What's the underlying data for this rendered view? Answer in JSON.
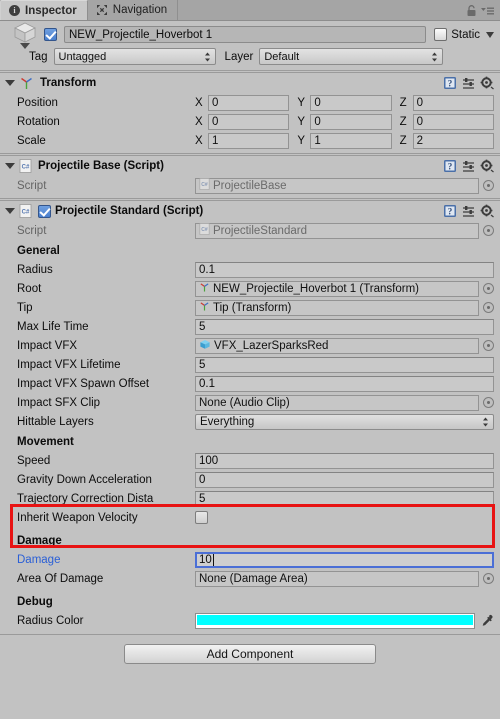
{
  "tabs": [
    {
      "label": "Inspector",
      "icon": "info-icon",
      "active": true
    },
    {
      "label": "Navigation",
      "icon": "navigation-icon",
      "active": false
    }
  ],
  "window_controls": {
    "lock": "lock-icon",
    "menu": "menu-icon"
  },
  "gameobject": {
    "icon": "gameobject-cube-icon",
    "enabled": true,
    "name": "NEW_Projectile_Hoverbot 1",
    "static_label": "Static",
    "static_checked": false,
    "tag_label": "Tag",
    "tag_value": "Untagged",
    "layer_label": "Layer",
    "layer_value": "Default"
  },
  "components": {
    "transform": {
      "title": "Transform",
      "icon": "transform-axis-icon",
      "rows": [
        {
          "label": "Position",
          "x": "0",
          "y": "0",
          "z": "0"
        },
        {
          "label": "Rotation",
          "x": "0",
          "y": "0",
          "z": "0"
        },
        {
          "label": "Scale",
          "x": "1",
          "y": "1",
          "z": "2"
        }
      ],
      "axes": {
        "x": "X",
        "y": "Y",
        "z": "Z"
      }
    },
    "projectile_base": {
      "title": "Projectile Base (Script)",
      "icon": "csharp-script-icon",
      "script_label": "Script",
      "script_value": "ProjectileBase"
    },
    "projectile_standard": {
      "title": "Projectile Standard (Script)",
      "icon": "csharp-script-icon",
      "enabled": true,
      "script_label": "Script",
      "script_value": "ProjectileStandard",
      "sections": {
        "general": {
          "header": "General",
          "radius_label": "Radius",
          "radius_value": "0.1",
          "root_label": "Root",
          "root_value": "NEW_Projectile_Hoverbot 1 (Transform)",
          "tip_label": "Tip",
          "tip_value": "Tip (Transform)",
          "max_life_label": "Max Life Time",
          "max_life_value": "5",
          "impact_vfx_label": "Impact VFX",
          "impact_vfx_value": "VFX_LazerSparksRed",
          "impact_vfx_lifetime_label": "Impact VFX Lifetime",
          "impact_vfx_lifetime_value": "5",
          "impact_vfx_offset_label": "Impact VFX Spawn Offset",
          "impact_vfx_offset_value": "0.1",
          "impact_sfx_label": "Impact SFX Clip",
          "impact_sfx_value": "None (Audio Clip)",
          "hittable_layers_label": "Hittable Layers",
          "hittable_layers_value": "Everything"
        },
        "movement": {
          "header": "Movement",
          "speed_label": "Speed",
          "speed_value": "100",
          "gravity_label": "Gravity Down Acceleration",
          "gravity_value": "0",
          "trajectory_label": "Trajectory Correction Dista",
          "trajectory_value": "5",
          "inherit_label": "Inherit Weapon Velocity",
          "inherit_checked": false
        },
        "damage": {
          "header": "Damage",
          "damage_label": "Damage",
          "damage_value": "10",
          "damage_focused": true,
          "area_label": "Area Of Damage",
          "area_value": "None (Damage Area)"
        },
        "debug": {
          "header": "Debug",
          "radius_color_label": "Radius Color",
          "radius_color_value": "#00FFFF"
        }
      }
    }
  },
  "add_component": {
    "label": "Add Component"
  },
  "colors": {
    "panel_bg": "#c2c2c2",
    "accent_blue": "#4b6fd6",
    "annotation_red": "#e81313",
    "link_blue": "#2a5fd6"
  }
}
